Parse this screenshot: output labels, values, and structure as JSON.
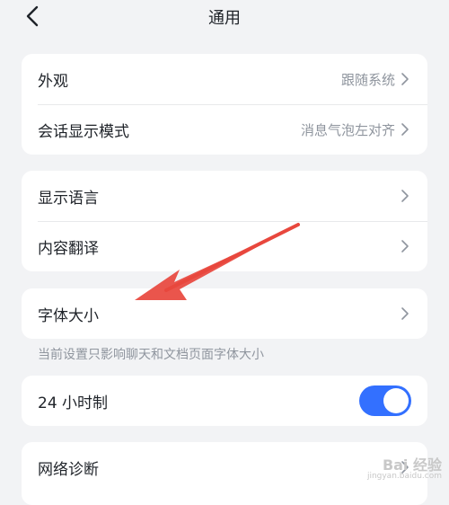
{
  "header": {
    "title": "通用",
    "back_icon": "chevron-left-icon"
  },
  "groups": {
    "appearance": {
      "appearance_label": "外观",
      "appearance_value": "跟随系统",
      "chat_mode_label": "会话显示模式",
      "chat_mode_value": "消息气泡左对齐"
    },
    "language": {
      "display_language_label": "显示语言",
      "translation_label": "内容翻译"
    },
    "font": {
      "font_size_label": "字体大小",
      "hint": "当前设置只影响聊天和文档页面字体大小"
    },
    "time": {
      "clock_label": "24 小时制",
      "clock_enabled": true
    },
    "network": {
      "diagnostics_label": "网络诊断"
    }
  },
  "colors": {
    "background": "#f2f3f5",
    "card": "#ffffff",
    "accent": "#3370ff",
    "annotation_arrow": "#e8473d",
    "secondary_text": "#8f959e"
  },
  "watermark": {
    "main": "Bai 经验",
    "sub": "jingyan.baidu.com"
  }
}
